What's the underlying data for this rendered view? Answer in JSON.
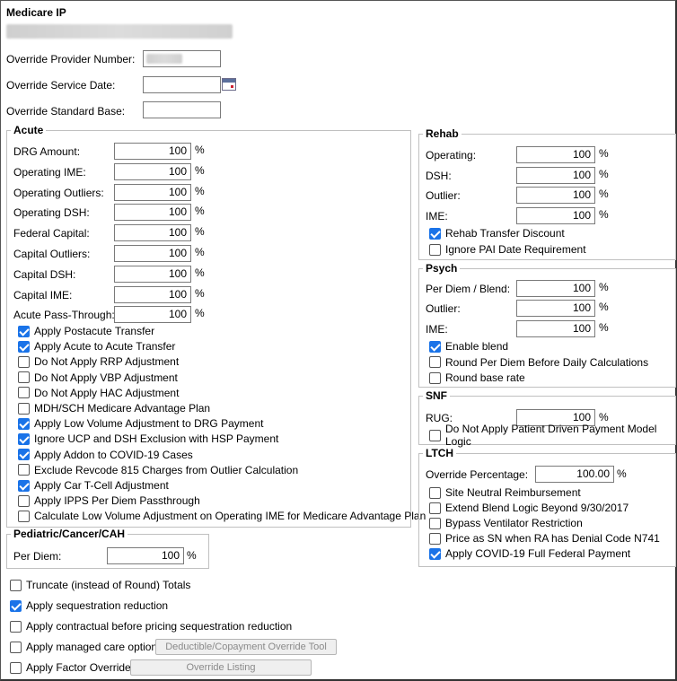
{
  "page": {
    "title": "Medicare IP"
  },
  "overrides": {
    "provider_number_label": "Override Provider Number:",
    "service_date_label": "Override Service Date:",
    "standard_base_label": "Override Standard Base:",
    "provider_number_value": "",
    "service_date_value": "",
    "standard_base_value": ""
  },
  "percent_sign": "%",
  "acute": {
    "legend": "Acute",
    "fields": [
      {
        "label": "DRG Amount:",
        "value": "100"
      },
      {
        "label": "Operating IME:",
        "value": "100"
      },
      {
        "label": "Operating Outliers:",
        "value": "100"
      },
      {
        "label": "Operating DSH:",
        "value": "100"
      },
      {
        "label": "Federal Capital:",
        "value": "100"
      },
      {
        "label": "Capital Outliers:",
        "value": "100"
      },
      {
        "label": "Capital DSH:",
        "value": "100"
      },
      {
        "label": "Capital IME:",
        "value": "100"
      },
      {
        "label": "Acute Pass-Through:",
        "value": "100"
      }
    ],
    "checkboxes": [
      {
        "label": "Apply Postacute Transfer",
        "checked": true
      },
      {
        "label": "Apply Acute to Acute Transfer",
        "checked": true
      },
      {
        "label": "Do Not Apply RRP Adjustment",
        "checked": false
      },
      {
        "label": "Do Not Apply VBP Adjustment",
        "checked": false
      },
      {
        "label": "Do Not Apply HAC Adjustment",
        "checked": false
      },
      {
        "label": "MDH/SCH Medicare Advantage Plan",
        "checked": false
      },
      {
        "label": "Apply Low Volume Adjustment to DRG Payment",
        "checked": true
      },
      {
        "label": "Ignore UCP and DSH Exclusion with HSP Payment",
        "checked": true
      },
      {
        "label": "Apply Addon to COVID-19 Cases",
        "checked": true
      },
      {
        "label": "Exclude Revcode 815 Charges from Outlier Calculation",
        "checked": false
      },
      {
        "label": "Apply Car T-Cell Adjustment",
        "checked": true
      },
      {
        "label": "Apply IPPS Per Diem Passthrough",
        "checked": false
      },
      {
        "label": "Calculate Low Volume Adjustment on Operating IME for Medicare Advantage Plan",
        "checked": false
      }
    ]
  },
  "pediatric": {
    "legend": "Pediatric/Cancer/CAH",
    "per_diem_label": "Per Diem:",
    "per_diem_value": "100"
  },
  "bottom": {
    "checkboxes": [
      {
        "label": "Truncate (instead of Round) Totals",
        "checked": false
      },
      {
        "label": "Apply sequestration reduction",
        "checked": true
      },
      {
        "label": "Apply contractual before pricing sequestration reduction",
        "checked": false
      },
      {
        "label": "Apply managed care options",
        "checked": false
      },
      {
        "label": "Apply Factor Overrides",
        "checked": false
      }
    ],
    "deductible_button": "Deductible/Copayment Override Tool",
    "override_listing_button": "Override Listing"
  },
  "rehab": {
    "legend": "Rehab",
    "fields": [
      {
        "label": "Operating:",
        "value": "100"
      },
      {
        "label": "DSH:",
        "value": "100"
      },
      {
        "label": "Outlier:",
        "value": "100"
      },
      {
        "label": "IME:",
        "value": "100"
      }
    ],
    "checkboxes": [
      {
        "label": "Rehab Transfer Discount",
        "checked": true
      },
      {
        "label": "Ignore PAI Date Requirement",
        "checked": false
      }
    ]
  },
  "psych": {
    "legend": "Psych",
    "fields": [
      {
        "label": "Per Diem / Blend:",
        "value": "100"
      },
      {
        "label": "Outlier:",
        "value": "100"
      },
      {
        "label": "IME:",
        "value": "100"
      }
    ],
    "checkboxes": [
      {
        "label": "Enable blend",
        "checked": true
      },
      {
        "label": "Round Per Diem Before Daily Calculations",
        "checked": false
      },
      {
        "label": "Round base rate",
        "checked": false
      }
    ]
  },
  "snf": {
    "legend": "SNF",
    "rug_label": "RUG:",
    "rug_value": "100",
    "checkboxes": [
      {
        "label": "Do Not Apply Patient Driven Payment Model Logic",
        "checked": false
      }
    ]
  },
  "ltch": {
    "legend": "LTCH",
    "override_label": "Override Percentage:",
    "override_value": "100.00",
    "checkboxes": [
      {
        "label": "Site Neutral Reimbursement",
        "checked": false
      },
      {
        "label": "Extend Blend Logic Beyond 9/30/2017",
        "checked": false
      },
      {
        "label": "Bypass Ventilator Restriction",
        "checked": false
      },
      {
        "label": "Price as SN when RA has Denial Code N741",
        "checked": false
      },
      {
        "label": "Apply COVID-19 Full Federal Payment",
        "checked": true
      }
    ]
  },
  "colors": {
    "checkbox_checked": "#1a73e8",
    "border": "#c0c0c0"
  }
}
